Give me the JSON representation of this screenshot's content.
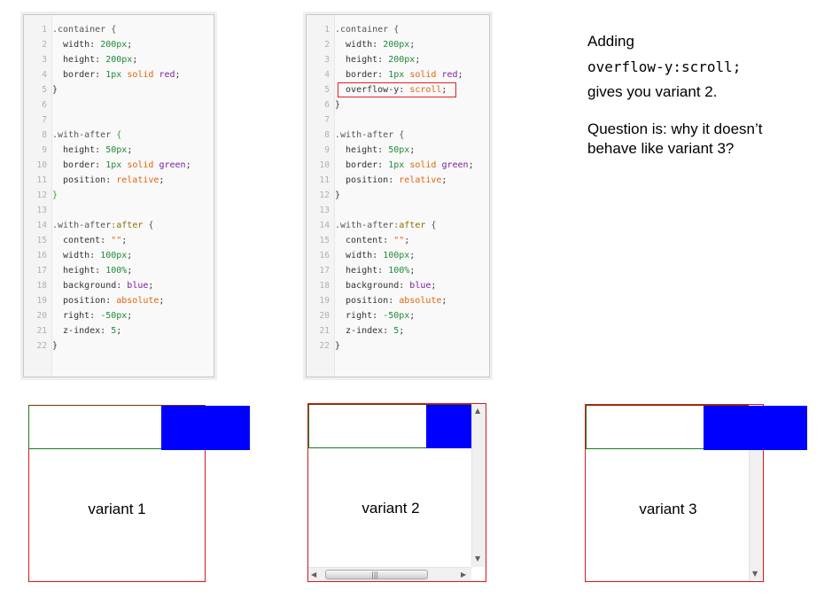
{
  "editor1": {
    "lines": [
      {
        "n": "1",
        "segs": [
          {
            "c": "sel",
            "t": ".container {"
          }
        ]
      },
      {
        "n": "2",
        "segs": [
          {
            "c": "prop",
            "t": "  width: "
          },
          {
            "c": "num",
            "t": "200px"
          },
          {
            "c": "prop",
            "t": ";"
          }
        ]
      },
      {
        "n": "3",
        "segs": [
          {
            "c": "prop",
            "t": "  height: "
          },
          {
            "c": "num",
            "t": "200px"
          },
          {
            "c": "prop",
            "t": ";"
          }
        ]
      },
      {
        "n": "4",
        "segs": [
          {
            "c": "prop",
            "t": "  border: "
          },
          {
            "c": "num",
            "t": "1px"
          },
          {
            "c": "prop",
            "t": " "
          },
          {
            "c": "kw",
            "t": "solid"
          },
          {
            "c": "prop",
            "t": " "
          },
          {
            "c": "col",
            "t": "red"
          },
          {
            "c": "prop",
            "t": ";"
          }
        ]
      },
      {
        "n": "5",
        "segs": [
          {
            "c": "brace",
            "t": "}"
          }
        ]
      },
      {
        "n": "6",
        "segs": []
      },
      {
        "n": "7",
        "segs": []
      },
      {
        "n": "8",
        "segs": [
          {
            "c": "sel",
            "t": ".with-after "
          },
          {
            "c": "gbrace",
            "t": "{"
          }
        ]
      },
      {
        "n": "9",
        "segs": [
          {
            "c": "prop",
            "t": "  height: "
          },
          {
            "c": "num",
            "t": "50px"
          },
          {
            "c": "prop",
            "t": ";"
          }
        ]
      },
      {
        "n": "10",
        "segs": [
          {
            "c": "prop",
            "t": "  border: "
          },
          {
            "c": "num",
            "t": "1px"
          },
          {
            "c": "prop",
            "t": " "
          },
          {
            "c": "kw",
            "t": "solid"
          },
          {
            "c": "prop",
            "t": " "
          },
          {
            "c": "col",
            "t": "green"
          },
          {
            "c": "prop",
            "t": ";"
          }
        ]
      },
      {
        "n": "11",
        "segs": [
          {
            "c": "prop",
            "t": "  position: "
          },
          {
            "c": "kw",
            "t": "relative"
          },
          {
            "c": "prop",
            "t": ";"
          }
        ]
      },
      {
        "n": "12",
        "segs": [
          {
            "c": "gbrace",
            "t": "}"
          }
        ]
      },
      {
        "n": "13",
        "segs": []
      },
      {
        "n": "14",
        "segs": [
          {
            "c": "sel",
            "t": ".with-after"
          },
          {
            "c": "pseudo",
            "t": ":after"
          },
          {
            "c": "sel",
            "t": " {"
          }
        ]
      },
      {
        "n": "15",
        "segs": [
          {
            "c": "prop",
            "t": "  content: "
          },
          {
            "c": "str",
            "t": "\"\""
          },
          {
            "c": "prop",
            "t": ";"
          }
        ]
      },
      {
        "n": "16",
        "segs": [
          {
            "c": "prop",
            "t": "  width: "
          },
          {
            "c": "num",
            "t": "100px"
          },
          {
            "c": "prop",
            "t": ";"
          }
        ]
      },
      {
        "n": "17",
        "segs": [
          {
            "c": "prop",
            "t": "  height: "
          },
          {
            "c": "num",
            "t": "100%"
          },
          {
            "c": "prop",
            "t": ";"
          }
        ]
      },
      {
        "n": "18",
        "segs": [
          {
            "c": "prop",
            "t": "  background: "
          },
          {
            "c": "col",
            "t": "blue"
          },
          {
            "c": "prop",
            "t": ";"
          }
        ]
      },
      {
        "n": "19",
        "segs": [
          {
            "c": "prop",
            "t": "  position: "
          },
          {
            "c": "kw",
            "t": "absolute"
          },
          {
            "c": "prop",
            "t": ";"
          }
        ]
      },
      {
        "n": "20",
        "segs": [
          {
            "c": "prop",
            "t": "  right: "
          },
          {
            "c": "num",
            "t": "-50px"
          },
          {
            "c": "prop",
            "t": ";"
          }
        ]
      },
      {
        "n": "21",
        "segs": [
          {
            "c": "prop",
            "t": "  z-index: "
          },
          {
            "c": "num",
            "t": "5"
          },
          {
            "c": "prop",
            "t": ";"
          }
        ]
      },
      {
        "n": "22",
        "segs": [
          {
            "c": "brace",
            "t": "}"
          }
        ]
      }
    ]
  },
  "editor2": {
    "lines": [
      {
        "n": "1",
        "segs": [
          {
            "c": "sel",
            "t": ".container {"
          }
        ]
      },
      {
        "n": "2",
        "segs": [
          {
            "c": "prop",
            "t": "  width: "
          },
          {
            "c": "num",
            "t": "200px"
          },
          {
            "c": "prop",
            "t": ";"
          }
        ]
      },
      {
        "n": "3",
        "segs": [
          {
            "c": "prop",
            "t": "  height: "
          },
          {
            "c": "num",
            "t": "200px"
          },
          {
            "c": "prop",
            "t": ";"
          }
        ]
      },
      {
        "n": "4",
        "segs": [
          {
            "c": "prop",
            "t": "  border: "
          },
          {
            "c": "num",
            "t": "1px"
          },
          {
            "c": "prop",
            "t": " "
          },
          {
            "c": "kw",
            "t": "solid"
          },
          {
            "c": "prop",
            "t": " "
          },
          {
            "c": "col",
            "t": "red"
          },
          {
            "c": "prop",
            "t": ";"
          }
        ]
      },
      {
        "n": "5",
        "segs": [
          {
            "c": "prop",
            "t": "  overflow-y: "
          },
          {
            "c": "kw",
            "t": "scroll"
          },
          {
            "c": "prop",
            "t": ";"
          }
        ]
      },
      {
        "n": "6",
        "segs": [
          {
            "c": "brace",
            "t": "}"
          }
        ]
      },
      {
        "n": "7",
        "segs": []
      },
      {
        "n": "8",
        "segs": [
          {
            "c": "sel",
            "t": ".with-after {"
          }
        ]
      },
      {
        "n": "9",
        "segs": [
          {
            "c": "prop",
            "t": "  height: "
          },
          {
            "c": "num",
            "t": "50px"
          },
          {
            "c": "prop",
            "t": ";"
          }
        ]
      },
      {
        "n": "10",
        "segs": [
          {
            "c": "prop",
            "t": "  border: "
          },
          {
            "c": "num",
            "t": "1px"
          },
          {
            "c": "prop",
            "t": " "
          },
          {
            "c": "kw",
            "t": "solid"
          },
          {
            "c": "prop",
            "t": " "
          },
          {
            "c": "col",
            "t": "green"
          },
          {
            "c": "prop",
            "t": ";"
          }
        ]
      },
      {
        "n": "11",
        "segs": [
          {
            "c": "prop",
            "t": "  position: "
          },
          {
            "c": "kw",
            "t": "relative"
          },
          {
            "c": "prop",
            "t": ";"
          }
        ]
      },
      {
        "n": "12",
        "segs": [
          {
            "c": "brace",
            "t": "}"
          }
        ]
      },
      {
        "n": "13",
        "segs": []
      },
      {
        "n": "14",
        "segs": [
          {
            "c": "sel",
            "t": ".with-after"
          },
          {
            "c": "pseudo",
            "t": ":after"
          },
          {
            "c": "sel",
            "t": " {"
          }
        ]
      },
      {
        "n": "15",
        "segs": [
          {
            "c": "prop",
            "t": "  content: "
          },
          {
            "c": "str",
            "t": "\"\""
          },
          {
            "c": "prop",
            "t": ";"
          }
        ]
      },
      {
        "n": "16",
        "segs": [
          {
            "c": "prop",
            "t": "  width: "
          },
          {
            "c": "num",
            "t": "100px"
          },
          {
            "c": "prop",
            "t": ";"
          }
        ]
      },
      {
        "n": "17",
        "segs": [
          {
            "c": "prop",
            "t": "  height: "
          },
          {
            "c": "num",
            "t": "100%"
          },
          {
            "c": "prop",
            "t": ";"
          }
        ]
      },
      {
        "n": "18",
        "segs": [
          {
            "c": "prop",
            "t": "  background: "
          },
          {
            "c": "col",
            "t": "blue"
          },
          {
            "c": "prop",
            "t": ";"
          }
        ]
      },
      {
        "n": "19",
        "segs": [
          {
            "c": "prop",
            "t": "  position: "
          },
          {
            "c": "kw",
            "t": "absolute"
          },
          {
            "c": "prop",
            "t": ";"
          }
        ]
      },
      {
        "n": "20",
        "segs": [
          {
            "c": "prop",
            "t": "  right: "
          },
          {
            "c": "num",
            "t": "-50px"
          },
          {
            "c": "prop",
            "t": ";"
          }
        ]
      },
      {
        "n": "21",
        "segs": [
          {
            "c": "prop",
            "t": "  z-index: "
          },
          {
            "c": "num",
            "t": "5"
          },
          {
            "c": "prop",
            "t": ";"
          }
        ]
      },
      {
        "n": "22",
        "segs": [
          {
            "c": "brace",
            "t": "}"
          }
        ]
      }
    ]
  },
  "explanation": {
    "line1": "Adding",
    "code": "overflow-y:scroll;",
    "line3": "gives you variant 2.",
    "question1": "Question is: why it doesn’t",
    "question2": "behave like variant 3?"
  },
  "variants": {
    "v1_label": "variant 1",
    "v2_label": "variant 2",
    "v3_label": "variant 3"
  },
  "icons": {
    "scroll_up": "▲",
    "scroll_down": "▼",
    "scroll_left": "◀",
    "scroll_right": "▶",
    "thumb_grip": "|||"
  },
  "colors": {
    "container_border": "#d01b1b",
    "after_background": "#0000ff",
    "with_after_border": "#1d7a1d"
  }
}
